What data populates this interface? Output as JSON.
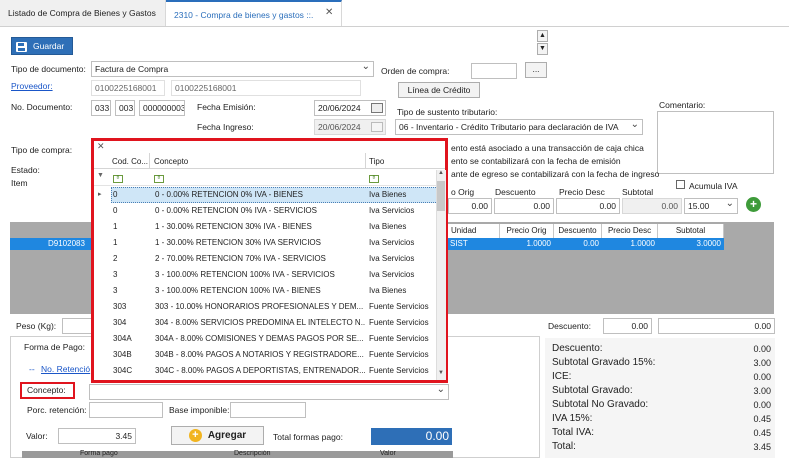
{
  "tabs": [
    {
      "label": "Listado de Compra de Bienes y Gastos"
    },
    {
      "label": "2310 - Compra de bienes y gastos ::.",
      "close": "✕"
    }
  ],
  "toolbar": {
    "save_label": "Guardar"
  },
  "form": {
    "tipo_documento_label": "Tipo de documento:",
    "tipo_documento_value": "Factura de Compra",
    "orden_compra_label": "Orden de compra:",
    "orden_compra_btn": "...",
    "proveedor_label": "Proveedor:",
    "proveedor_ruc": "0100225168001",
    "proveedor_ruc2": "0100225168001",
    "linea_credito_btn": "Línea de Crédito",
    "no_documento_label": "No. Documento:",
    "doc_part1": "033",
    "doc_part2": "003",
    "doc_part3": "000000003",
    "fecha_emision_label": "Fecha Emisión:",
    "fecha_emision": "20/06/2024",
    "fecha_ingreso_label": "Fecha Ingreso:",
    "fecha_ingreso": "20/06/2024",
    "sustento_label": "Tipo de sustento tributario:",
    "sustento_value": "06 - Inventario - Crédito Tributario para declaración de IVA",
    "comentario_label": "Comentario:",
    "tipo_compra_label": "Tipo de compra:",
    "estado_label": "Estado:",
    "item_label": "Item",
    "info1": "ento está asociado a una transacción de caja chica",
    "info2": "ento se contabilizará con la fecha de emisión",
    "info3": "ante de egreso se contabilizará con la fecha de ingreso",
    "acumula_iva": "Acumula IVA"
  },
  "item_row": {
    "precio_orig_label": "o Orig",
    "descuento_label": "Descuento",
    "precio_desc_label": "Precio Desc",
    "subtotal_label": "Subtotal",
    "precio_orig": "0.00",
    "descuento": "0.00",
    "precio_desc": "0.00",
    "subtotal": "0.00",
    "iva": "15.00"
  },
  "grid": {
    "headers": [
      "Unidad",
      "Precio Orig",
      "Descuento",
      "Precio Desc",
      "Subtotal"
    ],
    "row_code": "D9102083",
    "row": [
      "SIST",
      "1.0000",
      "0.00",
      "1.0000",
      "3.0000"
    ]
  },
  "popup": {
    "close": "✕",
    "headers": [
      "Cod. Co...",
      "Concepto",
      "Tipo"
    ],
    "filter_icon": "▼",
    "row_arrow": "▸",
    "rows": [
      [
        "0",
        "0 - 0.00% RETENCION 0% IVA - BIENES",
        "Iva Bienes"
      ],
      [
        "0",
        "0 - 0.00% RETENCION 0% IVA - SERVICIOS",
        "Iva Servicios"
      ],
      [
        "1",
        "1 - 30.00% RETENCION 30% IVA - BIENES",
        "Iva Bienes"
      ],
      [
        "1",
        "1 - 30.00% RETENCION 30% IVA SERVICIOS",
        "Iva Servicios"
      ],
      [
        "2",
        "2 - 70.00% RETENCION 70% IVA - SERVICIOS",
        "Iva Servicios"
      ],
      [
        "3",
        "3 - 100.00% RETENCION 100% IVA - SERVICIOS",
        "Iva Servicios"
      ],
      [
        "3",
        "3 - 100.00% RETENCION 100% IVA - BIENES",
        "Iva Bienes"
      ],
      [
        "303",
        "303 - 10.00% HONORARIOS PROFESIONALES Y DEM...",
        "Fuente Servicios"
      ],
      [
        "304",
        "304 - 8.00% SERVICIOS PREDOMINA EL INTELECTO N...",
        "Fuente Servicios"
      ],
      [
        "304A",
        "304A - 8.00% COMISIONES Y DEMAS PAGOS POR SE...",
        "Fuente Servicios"
      ],
      [
        "304B",
        "304B - 8.00% PAGOS A NOTARIOS Y REGISTRADORE...",
        "Fuente Servicios"
      ],
      [
        "304C",
        "304C - 8.00% PAGOS A DEPORTISTAS, ENTRENADOR...",
        "Fuente Servicios"
      ]
    ]
  },
  "bottom": {
    "peso_label": "Peso (Kg):",
    "descuento_label": "Descuento:",
    "descuento_val": "0.00",
    "descuento_val2": "0.00",
    "forma_pago_label": "Forma de Pago:",
    "no_retencion_label": "No. Retenció",
    "concepto_label": "Concepto:",
    "porc_retencion_label": "Porc. retención:",
    "base_imponible_label": "Base imponible:",
    "valor_label": "Valor:",
    "valor": "3.45",
    "agregar_btn": "Agregar",
    "total_formas_label": "Total formas pago:",
    "total_formas": "0.00",
    "col_forma_pago": "Forma pago",
    "col_descripcion": "Descripción",
    "col_valor": "Valor"
  },
  "totals": [
    {
      "label": "Descuento:",
      "value": "0.00"
    },
    {
      "label": "Subtotal Gravado 15%:",
      "value": "3.00"
    },
    {
      "label": "ICE:",
      "value": "0.00"
    },
    {
      "label": "Subtotal Gravado:",
      "value": "3.00"
    },
    {
      "label": "Subtotal No Gravado:",
      "value": "0.00"
    },
    {
      "label": "IVA 15%:",
      "value": "0.45"
    },
    {
      "label": "Total IVA:",
      "value": "0.45"
    },
    {
      "label": "Total:",
      "value": "3.45"
    }
  ],
  "colors": {
    "accent": "#2e6fb7",
    "highlight": "#e0141e",
    "selection": "#1f87e0"
  }
}
